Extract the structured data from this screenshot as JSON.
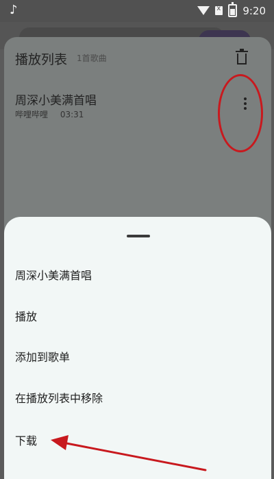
{
  "status_bar": {
    "time": "9:20"
  },
  "playlist": {
    "title": "播放列表",
    "count": "1首歌曲",
    "song": {
      "title": "周深小美满首唱",
      "source": "哔哩哔哩",
      "duration": "03:31"
    }
  },
  "menu": {
    "song_title": "周深小美满首唱",
    "items": [
      "播放",
      "添加到歌单",
      "在播放列表中移除",
      "下载"
    ]
  },
  "annotation_color": "#c8191e"
}
